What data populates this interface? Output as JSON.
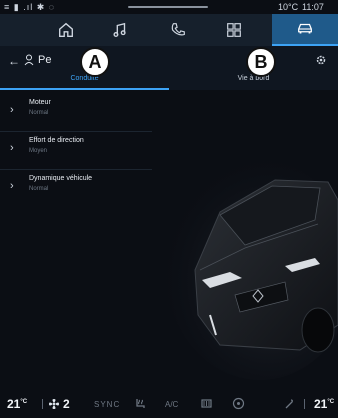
{
  "status": {
    "left_icons": "≡ ▮ .ıl ✱ ◌",
    "temperature": "10°C",
    "time": "11:07"
  },
  "nav": {
    "items": [
      {
        "icon": "home-icon"
      },
      {
        "icon": "music-icon"
      },
      {
        "icon": "phone-icon"
      },
      {
        "icon": "apps-icon"
      },
      {
        "icon": "car-icon",
        "active": true
      }
    ]
  },
  "header": {
    "title": "Pe",
    "tabs": [
      "Conduite",
      "Vie à bord"
    ]
  },
  "markers": {
    "a": "A",
    "b": "B"
  },
  "list": [
    {
      "label": "Moteur",
      "value": "Normal"
    },
    {
      "label": "Effort de direction",
      "value": "Moyen"
    },
    {
      "label": "Dynamique véhicule",
      "value": "Normal"
    }
  ],
  "climate": {
    "left_temp": "21",
    "left_unit": "°C",
    "fan": "2",
    "sync": "SYNC",
    "ac": "A/C",
    "right_temp": "21",
    "right_unit": "°C"
  },
  "colors": {
    "accent": "#3da3f5",
    "nav_active": "#1f5a8a",
    "background": "#0b0e14"
  }
}
